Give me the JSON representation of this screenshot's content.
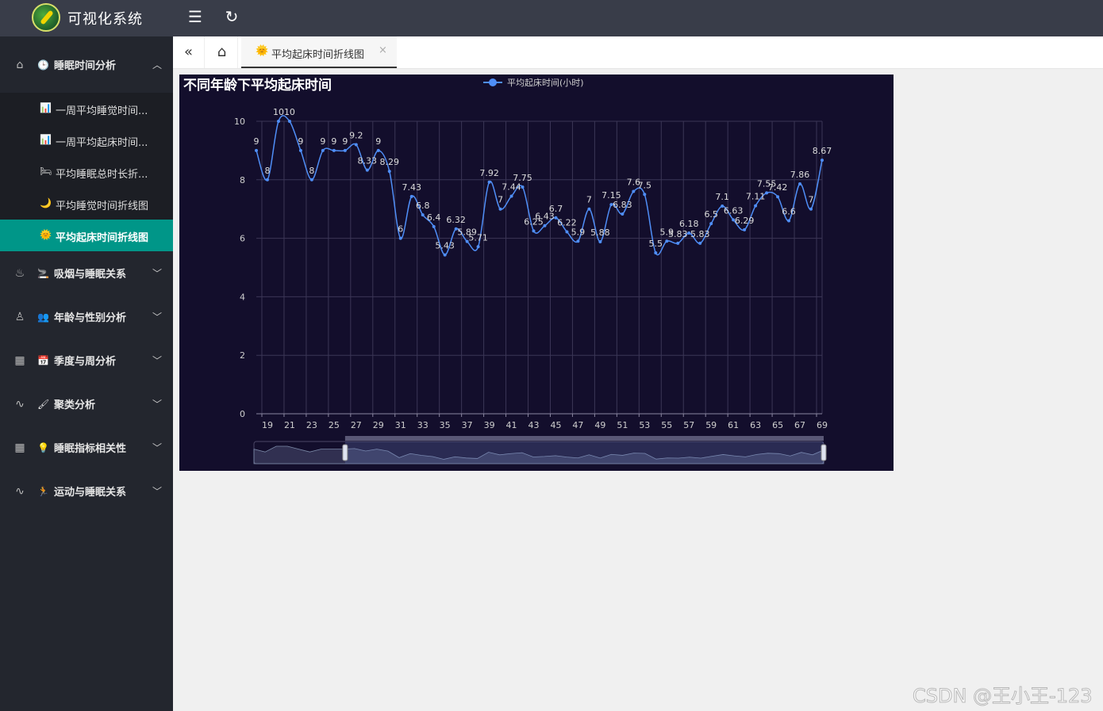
{
  "app": {
    "title": "可视化系统"
  },
  "topbar": {
    "menu_toggle_icon": "☰",
    "refresh_icon": "↻"
  },
  "sidebar": {
    "groups": [
      {
        "label": "睡眠时间分析",
        "lead_icon": "⌂",
        "icon": "🕒",
        "expanded": true,
        "items": [
          {
            "icon": "📊",
            "label": "一周平均睡觉时间..."
          },
          {
            "icon": "📊",
            "label": "一周平均起床时间..."
          },
          {
            "icon": "🛏",
            "label": "平均睡眠总时长折..."
          },
          {
            "icon": "🌙",
            "label": "平均睡觉时间折线图"
          },
          {
            "icon": "🌞",
            "label": "平均起床时间折线图",
            "active": true
          }
        ]
      },
      {
        "label": "吸烟与睡眠关系",
        "lead_icon": "♨",
        "icon": "🚬"
      },
      {
        "label": "年龄与性别分析",
        "lead_icon": "♙",
        "icon": "👥"
      },
      {
        "label": "季度与周分析",
        "lead_icon": "▦",
        "icon": "📅"
      },
      {
        "label": "聚类分析",
        "lead_icon": "∿",
        "icon": "🖌"
      },
      {
        "label": "睡眠指标相关性",
        "lead_icon": "▦",
        "icon": "💡"
      },
      {
        "label": "运动与睡眠关系",
        "lead_icon": "∿",
        "icon": "🏃"
      }
    ]
  },
  "tabs": {
    "collapse_icon": "«",
    "home_icon": "⌂",
    "active_tab": {
      "icon": "🌞",
      "label": "平均起床时间折线图",
      "close": "×"
    }
  },
  "chart_data": {
    "type": "line",
    "title": "不同年龄下平均起床时间",
    "legend": "平均起床时间(小时)",
    "legend_position": "top-center",
    "smooth": true,
    "ylim": [
      0,
      10
    ],
    "yticks": [
      0,
      2,
      4,
      6,
      8,
      10
    ],
    "grid": true,
    "series_color": "#4f8ef7",
    "x": [
      18,
      19,
      20,
      21,
      22,
      23,
      24,
      25,
      26,
      27,
      28,
      29,
      30,
      31,
      32,
      33,
      34,
      35,
      36,
      37,
      38,
      39,
      40,
      41,
      42,
      43,
      44,
      45,
      46,
      47,
      48,
      49,
      50,
      51,
      52,
      53,
      54,
      55,
      56,
      57,
      58,
      59,
      60,
      61,
      62,
      63,
      64,
      65,
      66,
      67,
      68,
      69
    ],
    "xtick_labels": [
      "19",
      "21",
      "23",
      "25",
      "27",
      "29",
      "31",
      "33",
      "35",
      "37",
      "39",
      "41",
      "43",
      "45",
      "47",
      "49",
      "51",
      "53",
      "55",
      "57",
      "59",
      "61",
      "63",
      "65",
      "67",
      "69"
    ],
    "values": [
      9,
      8,
      10,
      10,
      9,
      8,
      9,
      9,
      9,
      9.2,
      8.33,
      9,
      8.29,
      6,
      7.43,
      6.8,
      6.4,
      5.43,
      6.32,
      5.89,
      5.71,
      7.92,
      7,
      7.44,
      7.75,
      6.25,
      6.43,
      6.7,
      6.22,
      5.9,
      7,
      5.88,
      7.15,
      6.83,
      7.6,
      7.5,
      5.5,
      5.9,
      5.83,
      6.18,
      5.83,
      6.5,
      7.1,
      6.63,
      6.29,
      7.11,
      7.55,
      7.42,
      6.6,
      7.86,
      7,
      8.67
    ],
    "data_labels": [
      "9",
      "8",
      "10",
      "10",
      "9",
      "8",
      "9",
      "9",
      "9",
      "9.2",
      "8.33",
      "9",
      "8.29",
      "6",
      "7.43",
      "6.8",
      "6.4",
      "5.43",
      "6.32",
      "5.89",
      "5.71",
      "7.92",
      "7",
      "7.44",
      "7.75",
      "6.25",
      "6.43",
      "6.7",
      "6.22",
      "5.9",
      "7",
      "5.88",
      "7.15",
      "6.83",
      "7.6",
      "7.5",
      "5.5",
      "5.9",
      "5.83",
      "6.18",
      "5.83",
      "6.5",
      "7.1",
      "6.63",
      "6.29",
      "7.11",
      "7.55",
      "7.42",
      "6.6",
      "7.86",
      "7",
      "8.67"
    ],
    "datazoom": {
      "start_fraction": 0.16,
      "end_fraction": 1.0
    }
  },
  "watermark": "CSDN @王小王-123"
}
